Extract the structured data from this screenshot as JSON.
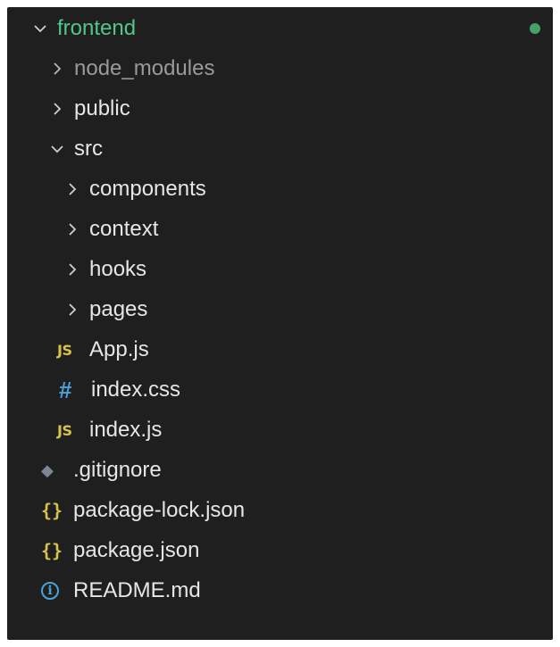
{
  "explorer": {
    "root": {
      "label": "frontend",
      "icon": "chevron-down-icon",
      "status_dot_color": "#46a06a"
    },
    "items": [
      {
        "label": "node_modules",
        "type": "folder",
        "icon": "chevron-right-icon",
        "dimmed": true
      },
      {
        "label": "public",
        "type": "folder",
        "icon": "chevron-right-icon"
      },
      {
        "label": "src",
        "type": "folder",
        "icon": "chevron-down-icon",
        "expanded": true
      },
      {
        "label": "components",
        "type": "folder",
        "icon": "chevron-right-icon"
      },
      {
        "label": "context",
        "type": "folder",
        "icon": "chevron-right-icon"
      },
      {
        "label": "hooks",
        "type": "folder",
        "icon": "chevron-right-icon"
      },
      {
        "label": "pages",
        "type": "folder",
        "icon": "chevron-right-icon"
      },
      {
        "label": "App.js",
        "type": "file",
        "icon": "javascript-file-icon",
        "icon_text": "JS"
      },
      {
        "label": "index.css",
        "type": "file",
        "icon": "css-file-icon",
        "icon_text": "#"
      },
      {
        "label": "index.js",
        "type": "file",
        "icon": "javascript-file-icon",
        "icon_text": "JS"
      },
      {
        "label": ".gitignore",
        "type": "file",
        "icon": "git-file-icon",
        "icon_text": "◆"
      },
      {
        "label": "package-lock.json",
        "type": "file",
        "icon": "json-file-icon",
        "icon_text": "{}"
      },
      {
        "label": "package.json",
        "type": "file",
        "icon": "json-file-icon",
        "icon_text": "{}"
      },
      {
        "label": "README.md",
        "type": "file",
        "icon": "info-file-icon",
        "icon_text": "i"
      }
    ]
  },
  "colors": {
    "background": "#1f1f1f",
    "root_label": "#4fc88a",
    "text": "#e6e6e6",
    "dimmed_text": "#9a9a9a",
    "js_icon": "#d8c34a",
    "css_icon": "#4aa3d8",
    "json_icon": "#d8c34a",
    "info_icon": "#4aa3d8",
    "git_icon": "#7d8794"
  }
}
